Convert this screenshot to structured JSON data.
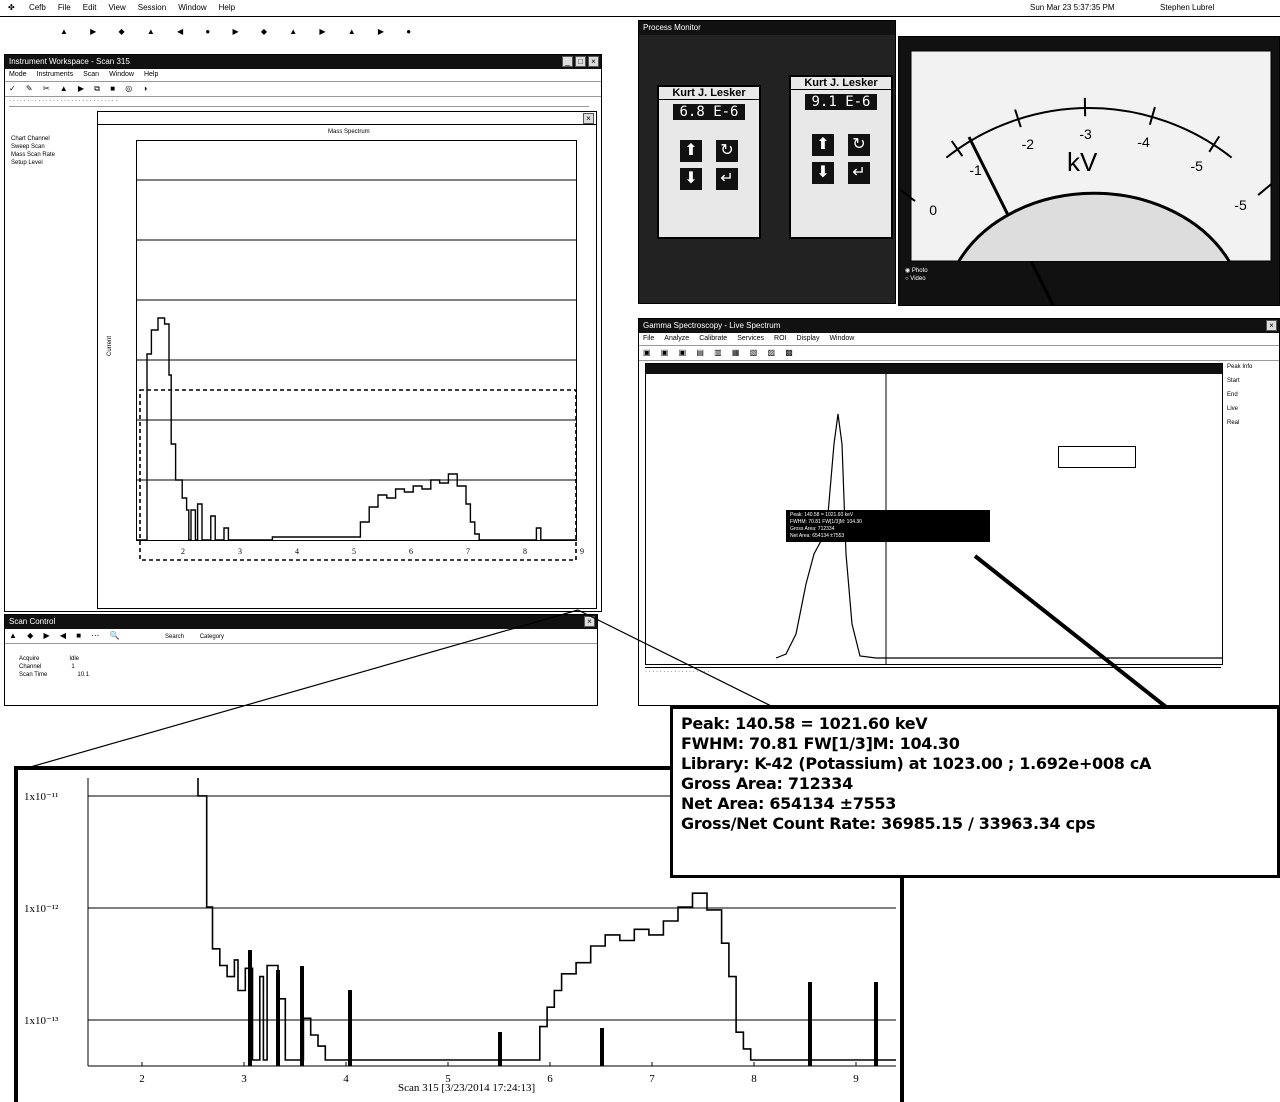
{
  "os_menubar": {
    "apple_glyph": "",
    "items": [
      "Cefb",
      "File",
      "Edit",
      "View",
      "Session",
      "Window",
      "Help"
    ],
    "right_status": "Sun Mar 23 5:37:35 PM",
    "user": "Stephen Lubrel"
  },
  "main_window": {
    "title": "Instrument Workspace - Scan 315",
    "menu": [
      "Mode",
      "Instruments",
      "Scan",
      "Window",
      "Help"
    ],
    "toolbar_glyphs": "✓ ✎ ✂ ▲ ▶ ⧉ ■ ◎ ◑",
    "sidebar_items": [
      "Chart Channel",
      "Sweep Scan",
      "Mass Scan Rate",
      "Setup Level"
    ],
    "plot": {
      "title": "Mass Spectrum",
      "ylabel": "Current"
    }
  },
  "lower_window": {
    "title": "Scan Control",
    "search_label": "Search",
    "filter_label": "Category",
    "rows": [
      [
        "Acquire",
        "Idle"
      ],
      [
        "Channel",
        "1"
      ],
      [
        "Scan Time",
        "10.1"
      ]
    ]
  },
  "camera_window": {
    "title": "Process Monitor",
    "gauge_brand_1": "Kurt J. Lesker",
    "gauge_brand_2": "Kurt J. Lesker",
    "gauge_reading_1": "6.8 E-6",
    "gauge_reading_2": "9.1 E-6"
  },
  "kv_meter": {
    "unit": "kV",
    "ticks": [
      "0",
      "-1",
      "-2",
      "-3",
      "-4",
      "-5",
      "-5"
    ],
    "radio_1": "Photo",
    "radio_2": "Video"
  },
  "spectrum_window": {
    "title": "Gamma Spectroscopy - Live Spectrum",
    "menu": [
      "File",
      "Analyze",
      "Calibrate",
      "Services",
      "ROI",
      "Display",
      "Window"
    ],
    "side_panel": [
      "Peak Info",
      "Start",
      "End",
      "Live",
      "Real"
    ],
    "tooltip_lines": [
      "Peak: 140.58 = 1021.60 keV",
      "FWHM: 70.81 FW[1/3]M: 104.30",
      "Gross Area: 712334",
      "Net Area: 654134 ±7553"
    ]
  },
  "callout": {
    "lines": [
      "Peak: 140.58 = 1021.60 keV",
      "FWHM: 70.81  FW[1/3]M: 104.30",
      "Library: K-42 (Potassium) at 1023.00 ;  1.692e+008 cA",
      "Gross Area: 712334",
      "Net Area: 654134 ±7553",
      "Gross/Net Count Rate: 36985.15 / 33963.34 cps"
    ]
  },
  "zoom_plot": {
    "y_ticks": [
      "1x10⁻¹¹",
      "1x10⁻¹²",
      "1x10⁻¹³"
    ],
    "x_ticks": [
      "2",
      "3",
      "4",
      "5",
      "6",
      "7",
      "8",
      "9"
    ],
    "xlabel": "Scan 315 [3/23/2014 17:24:13]"
  },
  "colors": {
    "ink": "#000000",
    "paper": "#ffffff",
    "photo_dark": "#222222"
  }
}
